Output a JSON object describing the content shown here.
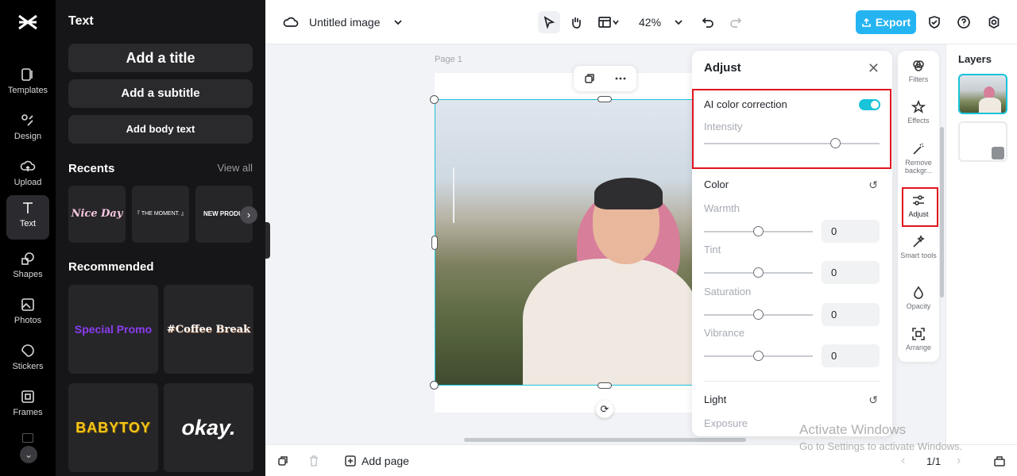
{
  "rail": {
    "items": [
      {
        "label": "Templates"
      },
      {
        "label": "Design"
      },
      {
        "label": "Upload"
      },
      {
        "label": "Text"
      },
      {
        "label": "Shapes"
      },
      {
        "label": "Photos"
      },
      {
        "label": "Stickers"
      },
      {
        "label": "Frames"
      }
    ],
    "active": "Text"
  },
  "panel": {
    "title": "Text",
    "add_title": "Add a title",
    "add_subtitle": "Add a subtitle",
    "add_body": "Add body text",
    "recents_title": "Recents",
    "view_all": "View all",
    "recents": [
      "Nice Day",
      "『 THE MOMENT. 』",
      "NEW PRODUC"
    ],
    "recommended_title": "Recommended",
    "templates": [
      "Special Promo",
      "#Coffee Break",
      "BABYTOY",
      "okay."
    ]
  },
  "topbar": {
    "doc_title": "Untitled image",
    "zoom": "42%",
    "export_label": "Export"
  },
  "canvas": {
    "page_label": "Page 1"
  },
  "adjust": {
    "title": "Adjust",
    "ai_label": "AI color correction",
    "ai_enabled": true,
    "intensity_label": "Intensity",
    "intensity_level": 0.75,
    "color_title": "Color",
    "color_sliders": [
      {
        "label": "Warmth",
        "value": "0"
      },
      {
        "label": "Tint",
        "value": "0"
      },
      {
        "label": "Saturation",
        "value": "0"
      },
      {
        "label": "Vibrance",
        "value": "0"
      }
    ],
    "light_title": "Light",
    "exposure_label": "Exposure"
  },
  "strip": {
    "items": [
      "Filters",
      "Effects",
      "Remove backgr...",
      "Adjust",
      "Smart tools",
      "Opacity",
      "Arrange"
    ]
  },
  "layers": {
    "title": "Layers"
  },
  "bottombar": {
    "add_page": "Add page",
    "pager": "1/1"
  },
  "watermark": {
    "line1": "Activate Windows",
    "line2": "Go to Settings to activate Windows."
  },
  "colors": {
    "accent": "#19c3d9",
    "export": "#25b4f2",
    "highlight": "#e0141e"
  }
}
